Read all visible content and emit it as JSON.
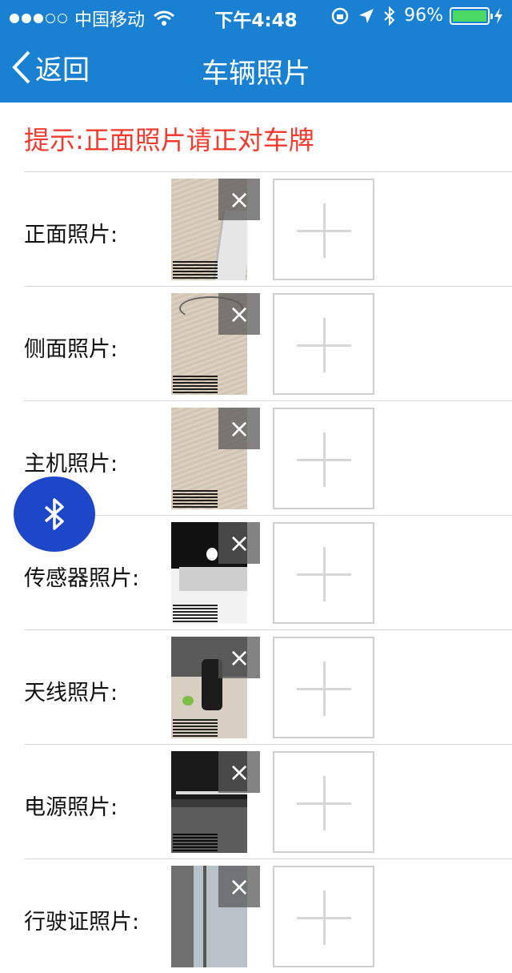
{
  "status_bar": {
    "carrier": "中国移动",
    "time": "下午4:48",
    "battery_percent": "96%",
    "signal_bars_filled": 3,
    "signal_bars_total": 5,
    "battery_level": 0.96,
    "battery_color": "#4cd964"
  },
  "nav": {
    "back_label": "返回",
    "title": "车辆照片",
    "bar_color": "#1a80d2"
  },
  "hint": {
    "text": "提示:正面照片请正对车牌",
    "color": "#f23a2e"
  },
  "rows": [
    {
      "label": "正面照片:",
      "photo_type": "wood-desk-keyboard"
    },
    {
      "label": "侧面照片:",
      "photo_type": "wood-desk-cable"
    },
    {
      "label": "主机照片:",
      "photo_type": "wood-desk"
    },
    {
      "label": "传感器照片:",
      "photo_type": "computer-base"
    },
    {
      "label": "天线照片:",
      "photo_type": "office-bottle"
    },
    {
      "label": "电源照片:",
      "photo_type": "office-ceiling"
    },
    {
      "label": "行驶证照片:",
      "photo_type": "office-window"
    }
  ],
  "icons": {
    "delete": "close-icon",
    "add": "plus-icon",
    "floating": "bluetooth-icon"
  },
  "fab_color": "#1e46c8"
}
